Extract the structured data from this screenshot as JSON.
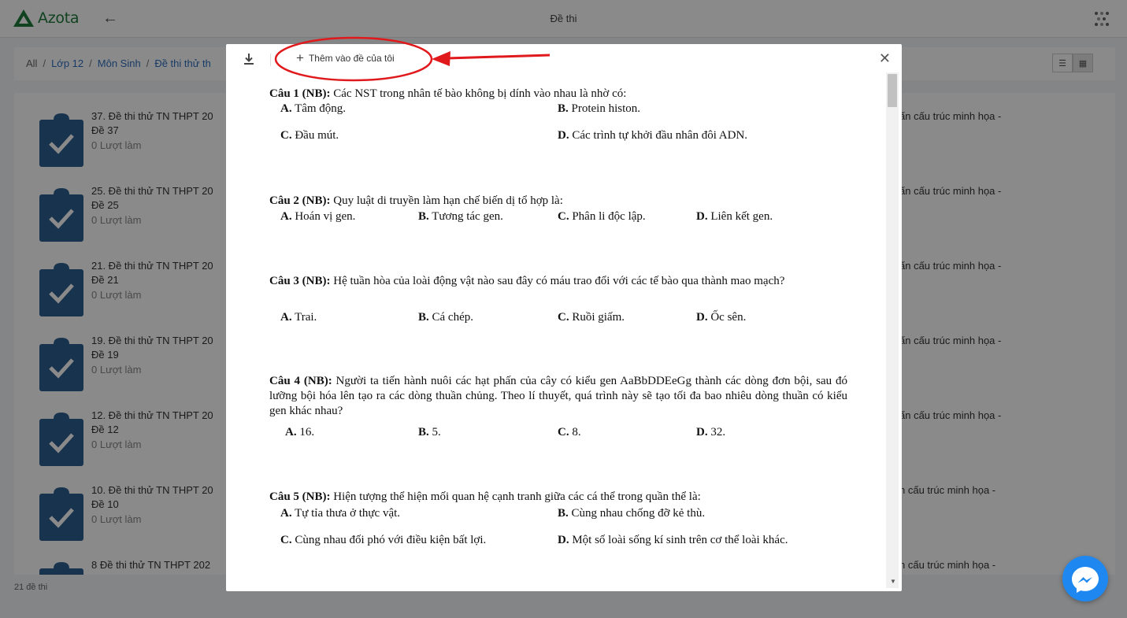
{
  "app": {
    "logo_text": "Azota",
    "title": "Đề thi",
    "brand_color": "#1f7a3a"
  },
  "breadcrumb": {
    "root": "All",
    "items": [
      "Lớp 12",
      "Môn Sinh",
      "Đề thi thử th"
    ]
  },
  "list": {
    "items": [
      {
        "title": "37. Đề thi thử TN THPT 20",
        "code": "Đề 37",
        "meta": "0 Lượt làm",
        "right": "ấn cấu trúc minh họa -"
      },
      {
        "title": "25. Đề thi thử TN THPT 20",
        "code": "Đề 25",
        "meta": "0 Lượt làm",
        "right": "ấn cấu trúc minh họa -"
      },
      {
        "title": "21. Đề thi thử TN THPT 20",
        "code": "Đề 21",
        "meta": "0 Lượt làm",
        "right": "ấn cấu trúc minh họa -"
      },
      {
        "title": "19. Đề thi thử TN THPT 20",
        "code": "Đề 19",
        "meta": "0 Lượt làm",
        "right": "ấn cấu trúc minh họa -"
      },
      {
        "title": "12. Đề thi thử TN THPT 20",
        "code": "Đề 12",
        "meta": "0 Lượt làm",
        "right": "ấn cấu trúc minh họa -"
      },
      {
        "title": "10. Đề thi thử TN THPT 20",
        "code": "Đề 10",
        "meta": "0 Lượt làm",
        "right": "n cấu trúc minh họa -"
      },
      {
        "title": "8 Đề thi thử TN THPT 202",
        "code": "",
        "meta": "",
        "right": "n cấu trúc minh họa -"
      }
    ],
    "count_text": "21 đề thi"
  },
  "modal": {
    "add_label": "Thêm vào đề của tôi",
    "questions": [
      {
        "label": "Câu 1 (NB):",
        "text": " Các NST trong nhân tế bào không bị dính vào nhau là nhờ có:",
        "options": [
          [
            "A.",
            " Tâm động."
          ],
          [
            "B.",
            " Protein histon."
          ],
          [
            "C.",
            " Đầu mút."
          ],
          [
            "D.",
            " Các trình tự khởi đầu nhân đôi ADN."
          ]
        ]
      },
      {
        "label": "Câu 2 (NB):",
        "text": " Quy luật di truyền làm hạn chế biến dị tổ hợp là:",
        "options": [
          [
            "A.",
            " Hoán vị gen."
          ],
          [
            "B.",
            " Tương tác gen."
          ],
          [
            "C.",
            " Phân li độc lập."
          ],
          [
            "D.",
            " Liên kết gen."
          ]
        ]
      },
      {
        "label": "Câu 3 (NB):",
        "text": " Hệ tuần hòa của loài động vật nào sau đây có máu trao đổi với các tế bào qua thành mao mạch?",
        "options": [
          [
            "A.",
            " Trai."
          ],
          [
            "B.",
            " Cá chép."
          ],
          [
            "C.",
            " Ruồi giấm."
          ],
          [
            "D.",
            " Ốc sên."
          ]
        ]
      },
      {
        "label": "Câu 4 (NB):",
        "text": " Người ta tiến hành nuôi các hạt phấn của cây có kiểu gen AaBbDDEeGg thành các dòng đơn bội, sau đó lưỡng bội hóa lên tạo ra các dòng thuần chủng. Theo lí thuyết, quá trình này sẽ tạo tối đa bao nhiêu dòng thuần có kiểu gen khác nhau?",
        "options": [
          [
            "A.",
            " 16."
          ],
          [
            "B.",
            " 5."
          ],
          [
            "C.",
            " 8."
          ],
          [
            "D.",
            " 32."
          ]
        ]
      },
      {
        "label": "Câu 5 (NB):",
        "text": " Hiện tượng thể hiện mối quan hệ cạnh tranh giữa các cá thể trong quần thể là:",
        "options": [
          [
            "A.",
            " Tự tỉa thưa ở thực vật."
          ],
          [
            "B.",
            " Cùng nhau chống đỡ kẻ thù."
          ],
          [
            "C.",
            " Cùng nhau đối phó với điều kiện bất lợi."
          ],
          [
            "D.",
            " Một số loài sống kí sinh trên cơ thể loài khác."
          ]
        ]
      }
    ]
  },
  "icons": {
    "download": "download-icon",
    "plus": "plus-icon",
    "close": "close-icon",
    "back": "arrow-left-icon",
    "apps": "apps-grid-icon",
    "exam": "clipboard-check-icon",
    "messenger": "messenger-icon"
  },
  "colors": {
    "accent": "#2f6fbf",
    "annotation": "#e0191c",
    "messenger": "#1e88f0",
    "exam_icon": "#2d5f8f"
  }
}
